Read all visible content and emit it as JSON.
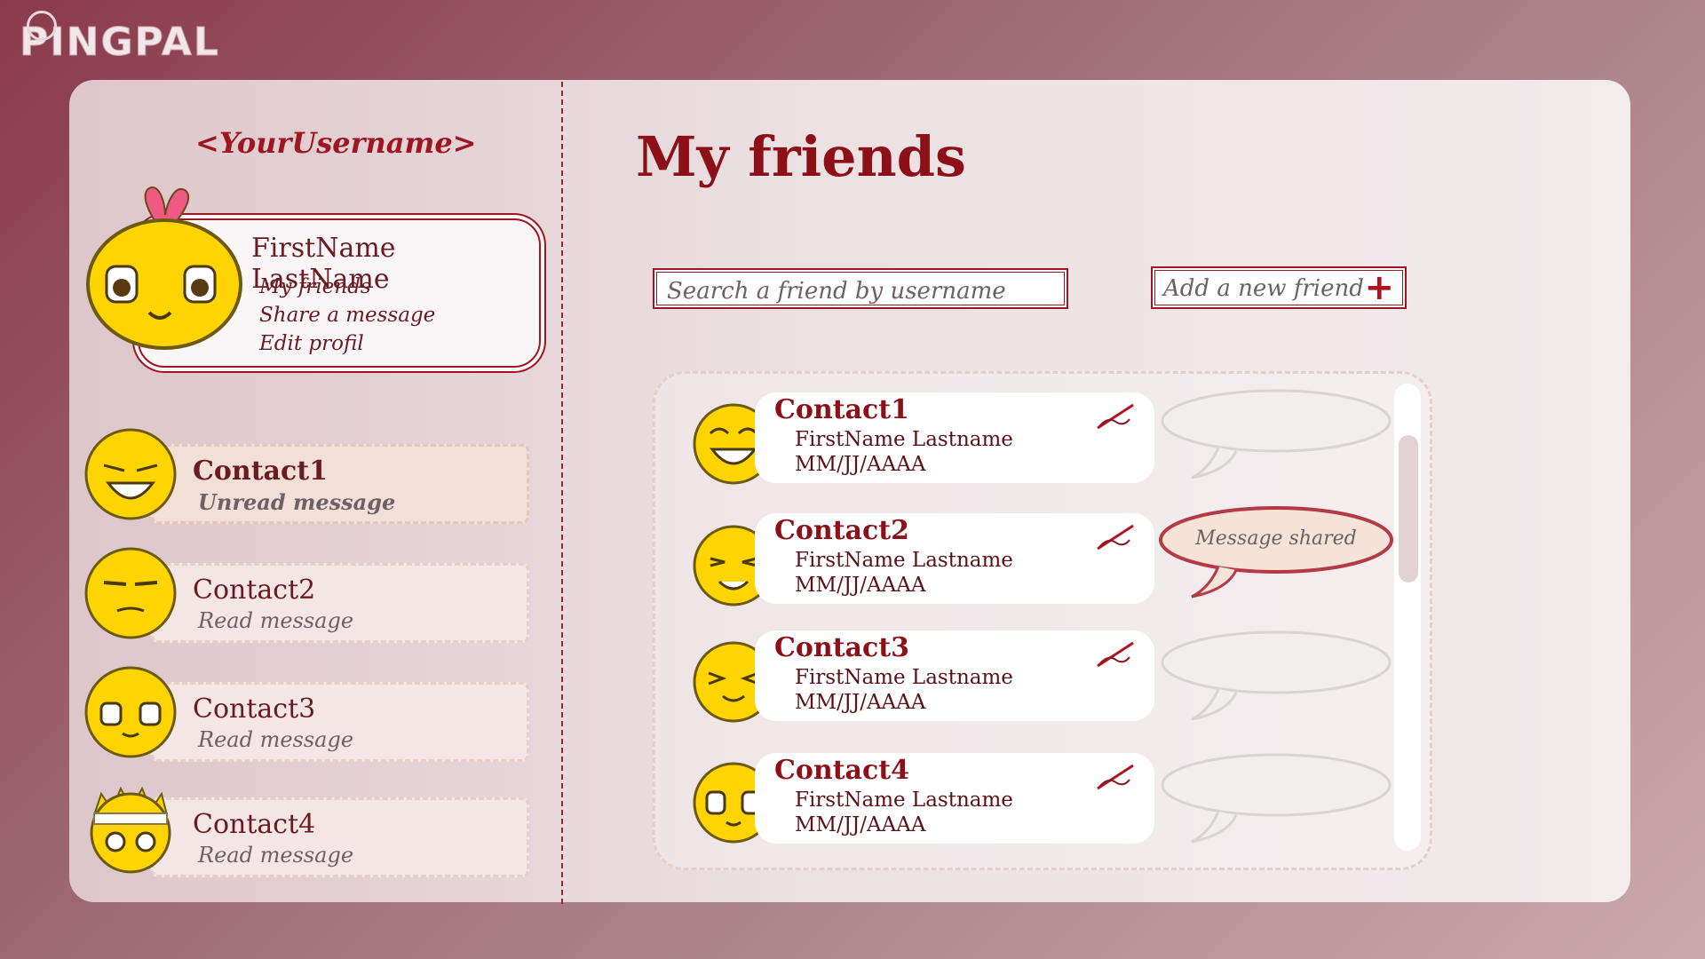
{
  "app": {
    "logo": "PINGPAL"
  },
  "sidebar": {
    "username": "<YourUsername>",
    "profile": {
      "name": "FirstName LastName",
      "menu": [
        "My friends",
        "Share a message",
        "Edit profil"
      ]
    },
    "contacts": [
      {
        "name": "Contact1",
        "status": "Unread message"
      },
      {
        "name": "Contact2",
        "status": "Read message"
      },
      {
        "name": "Contact3",
        "status": "Read message"
      },
      {
        "name": "Contact4",
        "status": "Read message"
      }
    ]
  },
  "main": {
    "title": "My friends",
    "search_placeholder": "Search a friend by username",
    "add_friend_label": "Add a new friend",
    "add_friend_icon": "+",
    "friends": [
      {
        "name": "Contact1",
        "fullname": "FirstName Lastname",
        "date": "MM/JJ/AAAA",
        "bubble": ""
      },
      {
        "name": "Contact2",
        "fullname": "FirstName Lastname",
        "date": "MM/JJ/AAAA",
        "bubble": "Message shared"
      },
      {
        "name": "Contact3",
        "fullname": "FirstName Lastname",
        "date": "MM/JJ/AAAA",
        "bubble": ""
      },
      {
        "name": "Contact4",
        "fullname": "FirstName Lastname",
        "date": "MM/JJ/AAAA",
        "bubble": ""
      }
    ]
  },
  "colors": {
    "accent": "#9d1622",
    "title": "#8d0f18",
    "emoji": "#ffd400"
  }
}
